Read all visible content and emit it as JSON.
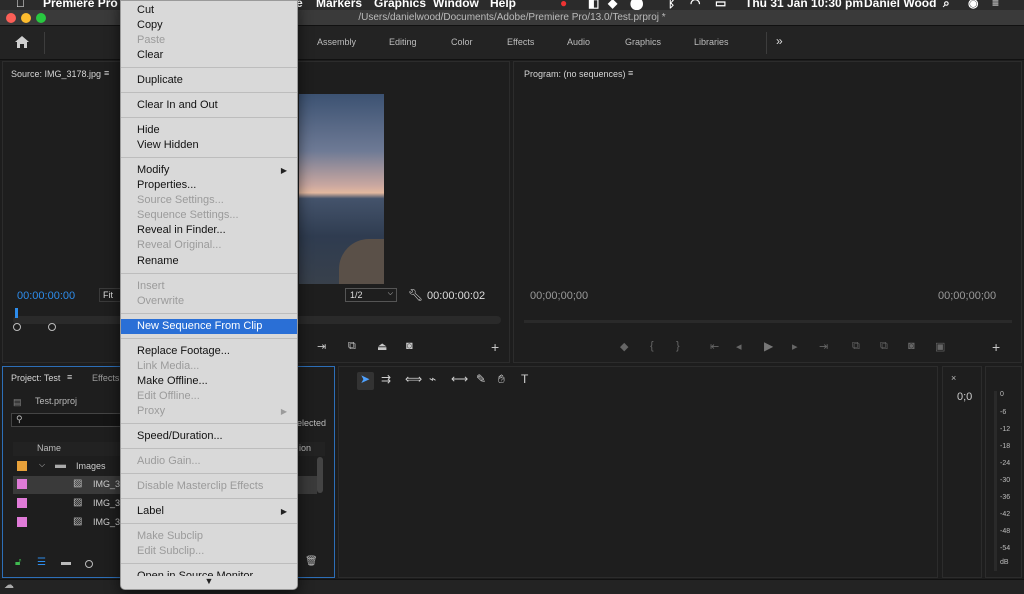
{
  "menubar": {
    "app_name": "Premiere Pro",
    "menus": [
      "Markers",
      "Graphics",
      "Window",
      "Help"
    ],
    "menu_partial": "e",
    "clock": "Thu 31 Jan  10:30 pm",
    "user": "Daniel Wood"
  },
  "window": {
    "document_path": "/Users/danielwood/Documents/Adobe/Premiere Pro/13.0/Test.prproj *"
  },
  "workspaces": {
    "tabs": [
      "Assembly",
      "Editing",
      "Color",
      "Effects",
      "Audio",
      "Graphics",
      "Libraries"
    ],
    "more": "»"
  },
  "source_panel": {
    "title": "Source: IMG_3178.jpg",
    "timecode_in": "00:00:00:00",
    "fit": "Fit",
    "resolution": "1/2",
    "timecode_out": "00:00:00:02"
  },
  "program_panel": {
    "title": "Program: (no sequences)",
    "timecode_left": "00;00;00;00",
    "timecode_right": "00;00;00;00"
  },
  "project_panel": {
    "title": "Project: Test",
    "effects_tab": "Effects",
    "project_file": "Test.prproj",
    "selected_text": "elected",
    "column_name": "Name",
    "column_other": "ion",
    "folder": "Images",
    "items": [
      "IMG_3",
      "IMG_3",
      "IMG_3"
    ]
  },
  "audio_meter": {
    "peak": "0;0",
    "scale": [
      "0",
      "-6",
      "-12",
      "-18",
      "-24",
      "-30",
      "-36",
      "-42",
      "-48",
      "-54",
      "dB"
    ]
  },
  "context_menu": {
    "items": [
      {
        "label": "Cut",
        "enabled": true
      },
      {
        "label": "Copy",
        "enabled": true
      },
      {
        "label": "Paste",
        "enabled": false
      },
      {
        "label": "Clear",
        "enabled": true
      },
      {
        "label": "Duplicate",
        "enabled": true
      },
      {
        "label": "Clear In and Out",
        "enabled": true
      },
      {
        "label": "Hide",
        "enabled": true
      },
      {
        "label": "View Hidden",
        "enabled": true
      },
      {
        "label": "Modify",
        "enabled": true
      },
      {
        "label": "Properties...",
        "enabled": true
      },
      {
        "label": "Source Settings...",
        "enabled": false
      },
      {
        "label": "Sequence Settings...",
        "enabled": false
      },
      {
        "label": "Reveal in Finder...",
        "enabled": true
      },
      {
        "label": "Reveal Original...",
        "enabled": false
      },
      {
        "label": "Rename",
        "enabled": true
      },
      {
        "label": "Insert",
        "enabled": false
      },
      {
        "label": "Overwrite",
        "enabled": false
      },
      {
        "label": "New Sequence From Clip",
        "enabled": true,
        "highlighted": true
      },
      {
        "label": "Replace Footage...",
        "enabled": true
      },
      {
        "label": "Link Media...",
        "enabled": false
      },
      {
        "label": "Make Offline...",
        "enabled": true
      },
      {
        "label": "Edit Offline...",
        "enabled": false
      },
      {
        "label": "Proxy",
        "enabled": false
      },
      {
        "label": "Speed/Duration...",
        "enabled": true
      },
      {
        "label": "Audio Gain...",
        "enabled": false
      },
      {
        "label": "Disable Masterclip Effects",
        "enabled": false
      },
      {
        "label": "Label",
        "enabled": true
      },
      {
        "label": "Make Subclip",
        "enabled": false
      },
      {
        "label": "Edit Subclip...",
        "enabled": false
      },
      {
        "label": "Open in Source Monitor",
        "enabled": true
      }
    ],
    "submenu_arrow": "▶",
    "scroll_arrow": "▼"
  },
  "colors": {
    "accent": "#2a6fd6",
    "timecode_blue": "#2d8ceb",
    "label_orange": "#e8a13a",
    "label_pink": "#e07bd8"
  }
}
